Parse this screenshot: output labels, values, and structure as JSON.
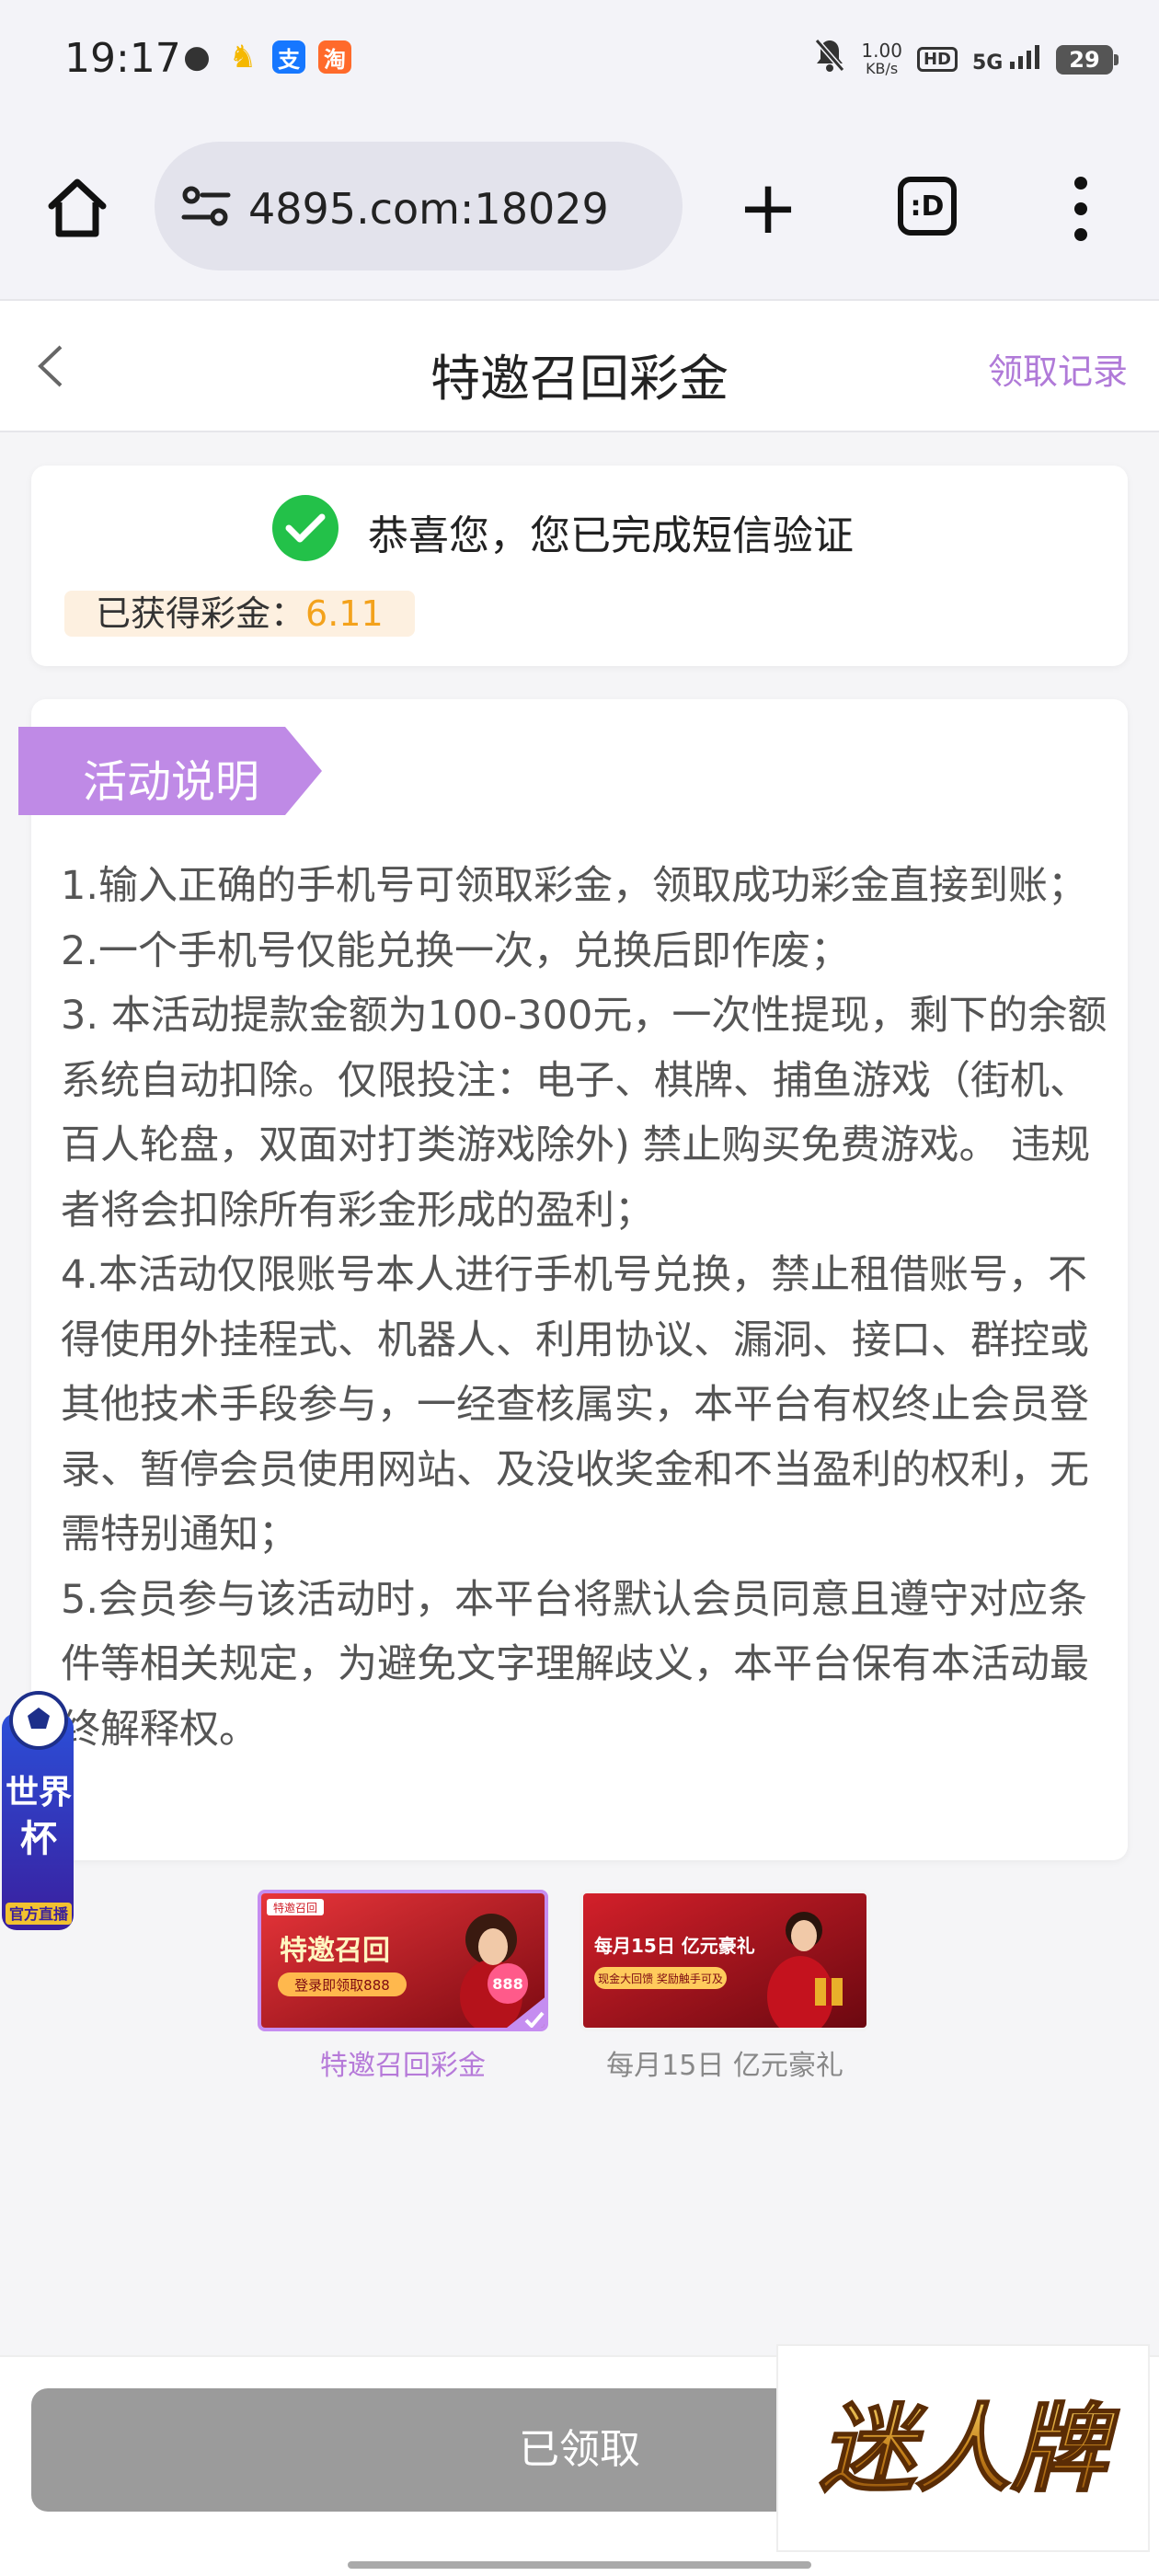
{
  "status_bar": {
    "time": "19:17",
    "speed_value": "1.00",
    "speed_unit": "KB/s",
    "hd": "HD",
    "network": "5G",
    "battery": "29"
  },
  "browser": {
    "url": "4895.com:18029",
    "tab_label": ":D"
  },
  "header": {
    "title": "特邀召回彩金",
    "records_link": "领取记录"
  },
  "success": {
    "message": "恭喜您，您已完成短信验证",
    "bonus_label": "已获得彩金：",
    "bonus_value": "6.11"
  },
  "activity": {
    "ribbon_title": "活动说明",
    "rules": [
      "1.输入正确的手机号可领取彩金，领取成功彩金直接到账；",
      "2.一个手机号仅能兑换一次，兑换后即作废；",
      "3. 本活动提款金额为100-300元，一次性提现，剩下的余额系统自动扣除。仅限投注：电子、棋牌、捕鱼游戏（街机、百人轮盘，双面对打类游戏除外) 禁止购买免费游戏。 违规者将会扣除所有彩金形成的盈利；",
      "4.本活动仅限账号本人进行手机号兑换，禁止租借账号，不得使用外挂程式、机器人、利用协议、漏洞、接口、群控或其他技术手段参与，一经查核属实，本平台有权终止会员登录、暂停会员使用网站、及没收奖金和不当盈利的权利，无需特别通知；",
      "5.会员参与该活动时，本平台将默认会员同意且遵守对应条件等相关规定，为避免文字理解歧义，本平台保有本活动最终解释权。"
    ]
  },
  "thumbnails": [
    {
      "caption": "特邀召回彩金",
      "banner_tag": "特邀召回",
      "banner_title": "特邀召回",
      "banner_sub": "登录即领取888",
      "banner_num": "888"
    },
    {
      "caption": "每月15日 亿元豪礼",
      "banner_title": "每月15日 亿元豪礼",
      "banner_sub": "现金大回馈 奖励触手可及"
    }
  ],
  "world_cup_badge": {
    "line1": "世界",
    "line2": "杯",
    "tag": "官方直播"
  },
  "bottom": {
    "claimed_label": "已领取",
    "brand": "迷人牌"
  },
  "colors": {
    "accent_purple": "#b07ad8",
    "success_green": "#23c149",
    "bonus_orange": "#f3a21c",
    "disabled_gray": "#9b9b9b"
  }
}
